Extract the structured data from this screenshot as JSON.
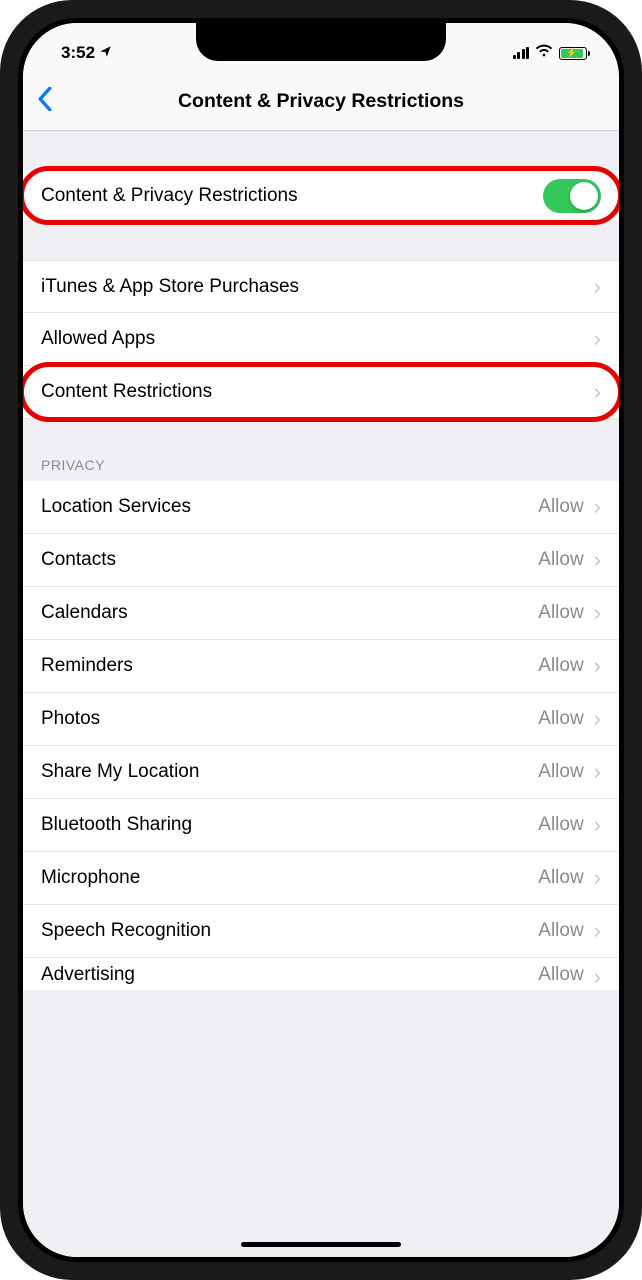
{
  "status": {
    "time": "3:52",
    "location_arrow": "➤"
  },
  "nav": {
    "title": "Content & Privacy Restrictions"
  },
  "toggle_row": {
    "label": "Content & Privacy Restrictions",
    "on": true
  },
  "store_rows": [
    {
      "label": "iTunes & App Store Purchases"
    },
    {
      "label": "Allowed Apps"
    },
    {
      "label": "Content Restrictions"
    }
  ],
  "privacy_header": "PRIVACY",
  "privacy_rows": [
    {
      "label": "Location Services",
      "value": "Allow"
    },
    {
      "label": "Contacts",
      "value": "Allow"
    },
    {
      "label": "Calendars",
      "value": "Allow"
    },
    {
      "label": "Reminders",
      "value": "Allow"
    },
    {
      "label": "Photos",
      "value": "Allow"
    },
    {
      "label": "Share My Location",
      "value": "Allow"
    },
    {
      "label": "Bluetooth Sharing",
      "value": "Allow"
    },
    {
      "label": "Microphone",
      "value": "Allow"
    },
    {
      "label": "Speech Recognition",
      "value": "Allow"
    },
    {
      "label": "Advertising",
      "value": "Allow"
    }
  ]
}
